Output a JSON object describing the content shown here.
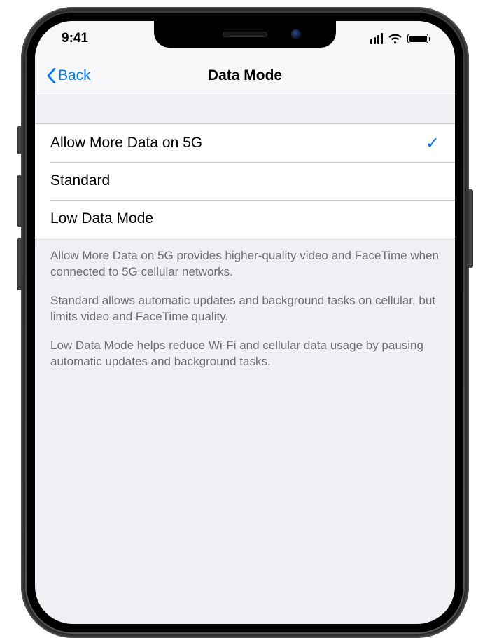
{
  "status": {
    "time": "9:41"
  },
  "nav": {
    "back_label": "Back",
    "title": "Data Mode"
  },
  "options": [
    {
      "label": "Allow More Data on 5G",
      "selected": true
    },
    {
      "label": "Standard",
      "selected": false
    },
    {
      "label": "Low Data Mode",
      "selected": false
    }
  ],
  "footer": {
    "p1": "Allow More Data on 5G provides higher-quality video and FaceTime when connected to 5G cellular networks.",
    "p2": "Standard allows automatic updates and background tasks on cellular, but limits video and FaceTime quality.",
    "p3": "Low Data Mode helps reduce Wi-Fi and cellular data usage by pausing automatic updates and background tasks."
  }
}
